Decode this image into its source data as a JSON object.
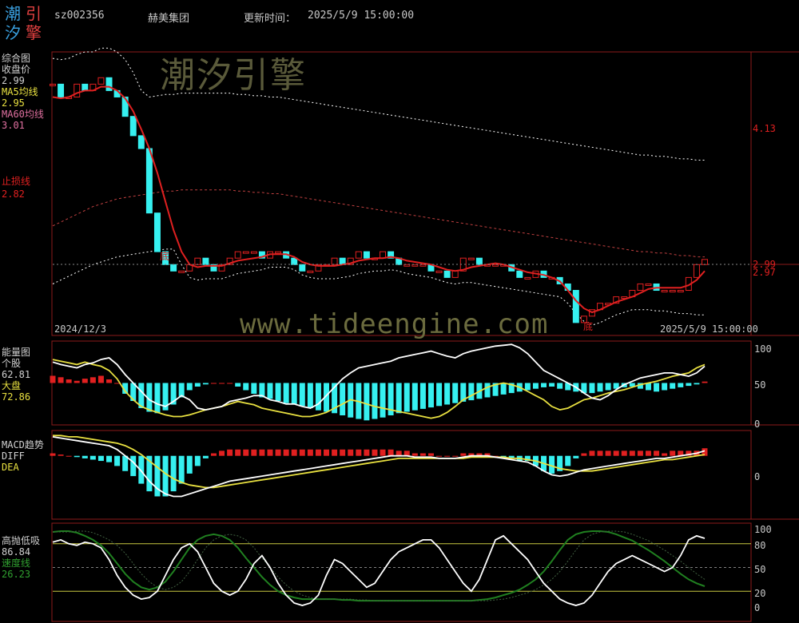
{
  "header": {
    "logo_chars": [
      "潮",
      "引",
      "汐",
      "擎"
    ],
    "code": "sz002356",
    "name": "赫美集团",
    "update_label": "更新时间：",
    "update_time": "2025/5/9 15:00:00"
  },
  "watermark": {
    "brand": "潮汐引擎",
    "url": "www.tideengine.com"
  },
  "colors": {
    "red": "#e02020",
    "cyan": "#36f0f0",
    "yellow": "#e8e040",
    "white": "#ffffff",
    "green": "#208020",
    "grid": "#8c1a1a"
  },
  "panels": {
    "main": {
      "title": "综合图",
      "close_label": "收盘价",
      "close_value": "2.99",
      "ma5_label": "MA5均线",
      "ma5_value": "2.95",
      "ma60_label": "MA60均线",
      "ma60_value": "3.01",
      "stop_label": "止损线",
      "stop_value": "2.82",
      "start_date": "2024/12/3",
      "end_date": "2025/5/9 15:00:00",
      "bottom_marks": [
        "底",
        "底"
      ],
      "right_ticks": [
        "4.13",
        "2.99",
        "2.97"
      ]
    },
    "energy": {
      "title": "能量图",
      "stock_label": "个股",
      "stock_value": "62.81",
      "market_label": "大盘",
      "market_value": "72.86",
      "ticks": [
        "100",
        "50",
        "0"
      ]
    },
    "macd": {
      "title": "MACD趋势",
      "diff_label": "DIFF",
      "dea_label": "DEA",
      "ticks": [
        "0"
      ]
    },
    "hilo": {
      "title": "高抛低吸",
      "value": "86.84",
      "speed_label": "速度线",
      "speed_value": "26.23",
      "ticks": [
        "100",
        "80",
        "50",
        "20",
        "0"
      ]
    }
  },
  "chart_data": [
    {
      "type": "line",
      "title": "综合图",
      "ylim": [
        2.4,
        4.6
      ],
      "candles_close": [
        4.35,
        4.25,
        4.25,
        4.35,
        4.3,
        4.35,
        4.4,
        4.3,
        4.25,
        4.1,
        3.95,
        3.85,
        3.35,
        3.05,
        2.95,
        2.9,
        2.9,
        2.95,
        3.0,
        2.95,
        2.9,
        2.95,
        3.0,
        3.05,
        3.05,
        3.05,
        3.0,
        3.05,
        3.05,
        3.0,
        2.95,
        2.9,
        2.9,
        2.95,
        2.95,
        3.0,
        2.95,
        3.0,
        3.05,
        3.0,
        3.0,
        3.05,
        3.0,
        2.95,
        2.95,
        2.95,
        2.95,
        2.9,
        2.9,
        2.85,
        2.9,
        3.0,
        3.0,
        2.95,
        2.95,
        2.95,
        2.95,
        2.9,
        2.85,
        2.85,
        2.9,
        2.85,
        2.85,
        2.8,
        2.75,
        2.5,
        2.55,
        2.6,
        2.65,
        2.65,
        2.7,
        2.7,
        2.75,
        2.8,
        2.8,
        2.75,
        2.75,
        2.75,
        2.75,
        2.85,
        2.95,
        2.99
      ],
      "ma5": [
        4.25,
        4.24,
        4.25,
        4.28,
        4.3,
        4.3,
        4.33,
        4.33,
        4.3,
        4.24,
        4.14,
        4.0,
        3.85,
        3.66,
        3.44,
        3.22,
        3.05,
        2.95,
        2.93,
        2.94,
        2.94,
        2.94,
        2.96,
        2.98,
        2.99,
        3.0,
        3.01,
        3.03,
        3.03,
        3.03,
        3.01,
        2.97,
        2.95,
        2.94,
        2.94,
        2.94,
        2.95,
        2.96,
        2.98,
        2.99,
        3.0,
        3.0,
        3.01,
        3.0,
        2.98,
        2.97,
        2.96,
        2.95,
        2.93,
        2.91,
        2.9,
        2.91,
        2.93,
        2.94,
        2.95,
        2.96,
        2.95,
        2.93,
        2.91,
        2.89,
        2.88,
        2.87,
        2.85,
        2.82,
        2.75,
        2.67,
        2.61,
        2.58,
        2.6,
        2.63,
        2.66,
        2.68,
        2.7,
        2.73,
        2.76,
        2.77,
        2.77,
        2.77,
        2.77,
        2.79,
        2.83,
        2.9
      ],
      "ma60": [
        3.25,
        3.28,
        3.31,
        3.34,
        3.37,
        3.4,
        3.42,
        3.44,
        3.46,
        3.47,
        3.48,
        3.49,
        3.5,
        3.51,
        3.52,
        3.52,
        3.53,
        3.53,
        3.53,
        3.53,
        3.53,
        3.53,
        3.53,
        3.52,
        3.52,
        3.51,
        3.51,
        3.5,
        3.5,
        3.49,
        3.48,
        3.47,
        3.46,
        3.45,
        3.44,
        3.43,
        3.42,
        3.41,
        3.4,
        3.39,
        3.38,
        3.37,
        3.36,
        3.35,
        3.34,
        3.33,
        3.32,
        3.31,
        3.3,
        3.29,
        3.28,
        3.27,
        3.26,
        3.25,
        3.24,
        3.23,
        3.22,
        3.21,
        3.2,
        3.19,
        3.18,
        3.17,
        3.16,
        3.15,
        3.14,
        3.13,
        3.12,
        3.11,
        3.1,
        3.09,
        3.08,
        3.07,
        3.06,
        3.05,
        3.05,
        3.04,
        3.04,
        3.03,
        3.02,
        3.02,
        3.01,
        3.01
      ]
    },
    {
      "type": "bar",
      "title": "能量图",
      "ylim": [
        0,
        100
      ],
      "stock": [
        75,
        72,
        70,
        68,
        72,
        74,
        78,
        80,
        72,
        60,
        50,
        40,
        30,
        25,
        22,
        28,
        35,
        30,
        20,
        18,
        20,
        22,
        28,
        30,
        32,
        35,
        35,
        30,
        28,
        25,
        25,
        22,
        20,
        25,
        35,
        45,
        55,
        62,
        68,
        70,
        72,
        74,
        76,
        80,
        82,
        84,
        86,
        88,
        85,
        82,
        80,
        85,
        88,
        90,
        92,
        94,
        95,
        96,
        92,
        85,
        75,
        65,
        60,
        55,
        50,
        45,
        38,
        32,
        30,
        35,
        42,
        48,
        52,
        56,
        58,
        60,
        62,
        62,
        60,
        58,
        62,
        70
      ],
      "market": [
        78,
        76,
        74,
        72,
        75,
        72,
        70,
        65,
        55,
        40,
        30,
        22,
        18,
        15,
        12,
        10,
        10,
        12,
        15,
        18,
        20,
        22,
        25,
        28,
        26,
        24,
        20,
        18,
        16,
        14,
        12,
        10,
        10,
        12,
        15,
        20,
        25,
        30,
        28,
        25,
        22,
        20,
        18,
        16,
        14,
        12,
        10,
        8,
        10,
        15,
        22,
        30,
        35,
        40,
        45,
        48,
        50,
        48,
        45,
        40,
        35,
        30,
        22,
        18,
        20,
        25,
        30,
        32,
        35,
        38,
        40,
        42,
        45,
        48,
        50,
        52,
        55,
        58,
        60,
        62,
        68,
        72
      ],
      "histogram": [
        10,
        8,
        5,
        3,
        6,
        8,
        10,
        5,
        0,
        -15,
        -25,
        -35,
        -40,
        -42,
        -38,
        -30,
        -20,
        -10,
        -5,
        -2,
        0,
        0,
        0,
        -5,
        -10,
        -15,
        -20,
        -22,
        -25,
        -28,
        -30,
        -32,
        -35,
        -38,
        -40,
        -42,
        -45,
        -48,
        -50,
        -52,
        -50,
        -48,
        -45,
        -42,
        -40,
        -38,
        -36,
        -34,
        -32,
        -30,
        -28,
        -26,
        -24,
        -22,
        -20,
        -18,
        -16,
        -14,
        -12,
        -10,
        -8,
        -6,
        -5,
        -8,
        -10,
        -12,
        -14,
        -14,
        -12,
        -10,
        -8,
        -6,
        -5,
        -8,
        -10,
        -12,
        -10,
        -8,
        -6,
        -4,
        -2,
        2
      ]
    },
    {
      "type": "line",
      "title": "MACD趋势",
      "ylim": [
        -0.5,
        0.2
      ],
      "diff": [
        0.15,
        0.14,
        0.13,
        0.12,
        0.11,
        0.1,
        0.09,
        0.08,
        0.05,
        0.0,
        -0.05,
        -0.12,
        -0.2,
        -0.26,
        -0.3,
        -0.32,
        -0.32,
        -0.3,
        -0.28,
        -0.26,
        -0.24,
        -0.22,
        -0.2,
        -0.19,
        -0.18,
        -0.17,
        -0.16,
        -0.15,
        -0.14,
        -0.13,
        -0.12,
        -0.11,
        -0.1,
        -0.09,
        -0.08,
        -0.07,
        -0.06,
        -0.05,
        -0.04,
        -0.03,
        -0.02,
        -0.01,
        0.0,
        0.0,
        0.0,
        -0.01,
        -0.01,
        -0.01,
        -0.02,
        -0.02,
        -0.02,
        -0.01,
        0.0,
        0.0,
        0.0,
        -0.01,
        -0.02,
        -0.03,
        -0.04,
        -0.05,
        -0.08,
        -0.12,
        -0.15,
        -0.16,
        -0.15,
        -0.13,
        -0.11,
        -0.1,
        -0.09,
        -0.08,
        -0.07,
        -0.06,
        -0.05,
        -0.04,
        -0.03,
        -0.02,
        -0.02,
        -0.01,
        0.0,
        0.01,
        0.02,
        0.04
      ],
      "dea": [
        0.16,
        0.16,
        0.15,
        0.15,
        0.14,
        0.13,
        0.12,
        0.11,
        0.1,
        0.08,
        0.05,
        0.01,
        -0.04,
        -0.09,
        -0.14,
        -0.18,
        -0.21,
        -0.23,
        -0.24,
        -0.25,
        -0.25,
        -0.24,
        -0.23,
        -0.22,
        -0.21,
        -0.2,
        -0.19,
        -0.18,
        -0.17,
        -0.16,
        -0.15,
        -0.14,
        -0.13,
        -0.12,
        -0.11,
        -0.1,
        -0.09,
        -0.08,
        -0.07,
        -0.06,
        -0.05,
        -0.04,
        -0.03,
        -0.02,
        -0.02,
        -0.02,
        -0.02,
        -0.02,
        -0.02,
        -0.02,
        -0.02,
        -0.02,
        -0.01,
        -0.01,
        -0.01,
        -0.01,
        -0.01,
        -0.02,
        -0.02,
        -0.03,
        -0.04,
        -0.06,
        -0.08,
        -0.1,
        -0.11,
        -0.12,
        -0.12,
        -0.12,
        -0.11,
        -0.1,
        -0.09,
        -0.08,
        -0.07,
        -0.06,
        -0.05,
        -0.04,
        -0.03,
        -0.03,
        -0.02,
        -0.01,
        0.0,
        0.01
      ],
      "histogram": [
        0.02,
        0.01,
        0.0,
        -0.01,
        -0.02,
        -0.03,
        -0.04,
        -0.05,
        -0.08,
        -0.12,
        -0.16,
        -0.22,
        -0.28,
        -0.32,
        -0.32,
        -0.28,
        -0.22,
        -0.14,
        -0.08,
        -0.02,
        0.02,
        0.04,
        0.05,
        0.05,
        0.05,
        0.05,
        0.05,
        0.05,
        0.05,
        0.05,
        0.05,
        0.05,
        0.05,
        0.05,
        0.05,
        0.05,
        0.05,
        0.05,
        0.05,
        0.05,
        0.05,
        0.05,
        0.05,
        0.04,
        0.04,
        0.02,
        0.02,
        0.02,
        0.0,
        0.0,
        0.0,
        0.02,
        0.02,
        0.02,
        0.02,
        0.0,
        -0.02,
        -0.02,
        -0.04,
        -0.04,
        -0.08,
        -0.12,
        -0.14,
        -0.12,
        -0.08,
        -0.02,
        0.02,
        0.04,
        0.04,
        0.04,
        0.04,
        0.04,
        0.04,
        0.04,
        0.04,
        0.04,
        0.02,
        0.04,
        0.04,
        0.04,
        0.04,
        0.06
      ]
    },
    {
      "type": "line",
      "title": "高抛低吸",
      "ylim": [
        0,
        100
      ],
      "hilo": [
        82,
        85,
        80,
        78,
        82,
        80,
        75,
        60,
        40,
        25,
        15,
        10,
        12,
        20,
        40,
        60,
        75,
        80,
        70,
        50,
        30,
        20,
        15,
        20,
        35,
        55,
        65,
        50,
        30,
        15,
        5,
        2,
        5,
        15,
        40,
        60,
        55,
        45,
        35,
        25,
        30,
        45,
        60,
        70,
        75,
        80,
        85,
        85,
        75,
        60,
        45,
        30,
        20,
        35,
        60,
        85,
        90,
        80,
        70,
        60,
        45,
        30,
        20,
        10,
        5,
        2,
        5,
        15,
        30,
        45,
        55,
        60,
        65,
        60,
        55,
        50,
        45,
        50,
        65,
        85,
        90,
        86.84
      ],
      "speed": [
        95,
        96,
        96,
        94,
        90,
        85,
        78,
        68,
        55,
        42,
        32,
        25,
        22,
        25,
        32,
        45,
        60,
        75,
        85,
        90,
        92,
        90,
        85,
        75,
        62,
        50,
        38,
        28,
        20,
        15,
        12,
        10,
        10,
        10,
        10,
        10,
        9,
        9,
        8,
        8,
        8,
        8,
        8,
        8,
        8,
        8,
        8,
        8,
        8,
        8,
        8,
        8,
        8,
        9,
        10,
        12,
        15,
        18,
        22,
        28,
        35,
        45,
        58,
        72,
        85,
        92,
        95,
        96,
        96,
        95,
        92,
        88,
        84,
        78,
        72,
        65,
        58,
        50,
        42,
        35,
        30,
        26.23
      ]
    }
  ]
}
